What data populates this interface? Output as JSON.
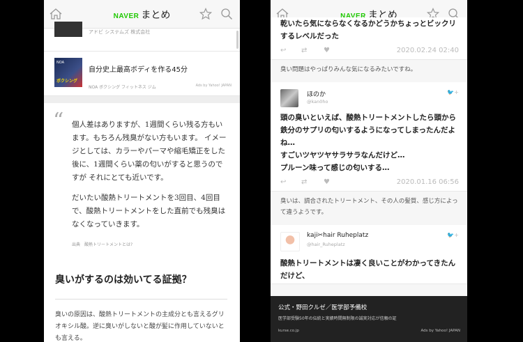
{
  "left": {
    "header": {
      "brand_naver": "NAVER",
      "brand_matome": "まとめ"
    },
    "top_ad": {
      "advertiser": "アドビ システムズ 株式会社"
    },
    "ad": {
      "thumb_top": "NOA",
      "thumb_text": "ボクシング",
      "title": "自分史上最高ボディを作る45分",
      "sponsor": "NOA ボクシング フィットネス ジム",
      "ads_by": "Ads by Yahoo! JAPAN"
    },
    "quote": {
      "paragraph1": "個人差はありますが、1週間くらい残る方もいます。もちろん残臭がない方もいます。 イメージとしては、カラーやパーマや縮毛矯正をした後に、1週間くらい薬の匂いがすると思うのですが それにとても近いです。",
      "paragraph2": "だいたい酸熱トリートメントを3回目、4回目で、酸熱トリートメントをした直前でも残臭はなくなっていきます。",
      "source": "出典　酸熱トリートメントとは?"
    },
    "heading": "臭いがするのは効いてる証拠？",
    "body": "臭いの原因は、酸熱トリートメントの主成分とも言えるグリオキシル酸。逆に臭いがしないと酸が髪に作用していないとも言える。\n酸熱トリートメントに使われる酸は複数あって、「グ"
  },
  "right": {
    "header": {
      "brand_naver": "NAVER",
      "brand_matome": "まとめ"
    },
    "tweet0": {
      "text": "乾いたら気にならなくなるかどうかちょっとビックリするレベルだった",
      "time": "2020.02.24 02:40"
    },
    "note1": "臭い問題はやっぱりみんな気になるみたいですね。",
    "tweet1": {
      "name": "ほのか",
      "handle": "@kan0ho",
      "text": "頭の臭いといえば、酸熱トリートメントしたら頭から鉄分のサプリの匂いするようになってしまったんだよね…\nすごいツヤツヤサラサラなんだけど…\nプルーン味って感じの匂いする…",
      "time": "2020.01.16 06:56"
    },
    "note2": "臭いは、調合されたトリートメント、その人の髪質、感じ方によって違うようです。",
    "tweet2": {
      "name": "kaji✂hair Ruheplatz",
      "handle": "@hair_Ruheplatz",
      "text": "酸熱トリートメントは凄く良いことがわかってきたんだけど、"
    },
    "banner": {
      "title": "公式・野田クルゼ／医学部予備校",
      "sub": "医学部受験50年の伝統と実績時間無制限の誠実対応が信頼の証",
      "domain": "kurse.co.jp",
      "ads_by": "Ads by Yahoo! JAPAN"
    }
  },
  "colors": {
    "naver_green": "#1ec800",
    "banner_bg": "#222222",
    "background": "#000000"
  }
}
